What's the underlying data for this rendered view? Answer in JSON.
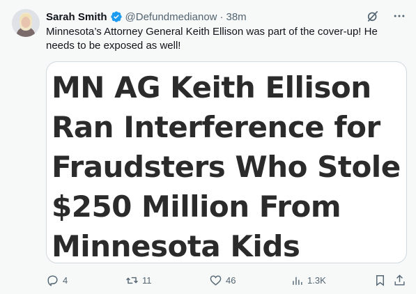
{
  "author": {
    "name": "Sarah Smith",
    "handle": "@Defundmedianow",
    "separator": "·",
    "time": "38m"
  },
  "tweet": {
    "text": "Minnesota’s Attorney General Keith Ellison was part of the cover-up! He needs to be exposed as well!"
  },
  "card": {
    "headline_lines": [
      "MN AG Keith Ellison",
      "Ran Interference for",
      "Fraudsters Who Stole",
      "$250 Million From",
      "Minnesota Kids"
    ]
  },
  "actions": {
    "replies": "4",
    "reposts": "11",
    "likes": "46",
    "views": "1.3K"
  },
  "colors": {
    "background": "#f7f9f9",
    "text": "#0f1419",
    "muted": "#536471",
    "verified": "#1d9bf0",
    "card_border": "#cfd9de"
  },
  "icons": [
    "verified-badge-icon",
    "grok-icon",
    "more-icon",
    "reply-icon",
    "repost-icon",
    "like-icon",
    "views-icon",
    "bookmark-icon",
    "share-icon"
  ]
}
